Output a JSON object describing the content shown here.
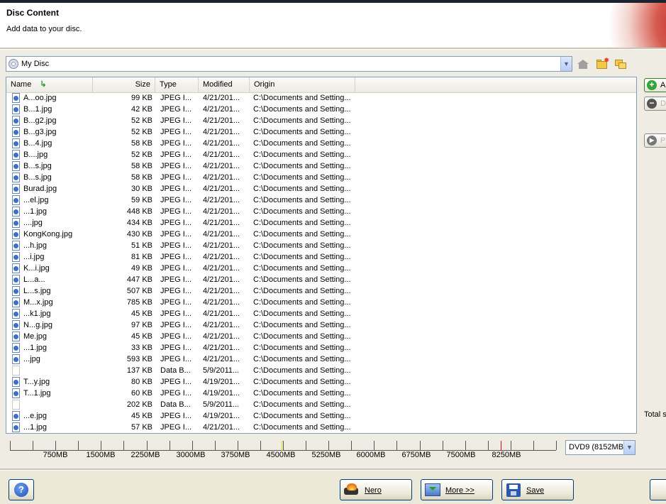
{
  "header": {
    "title": "Disc Content",
    "subtitle": "Add data to your disc."
  },
  "location": {
    "selected": "My Disc"
  },
  "columns": {
    "name": "Name",
    "size": "Size",
    "type": "Type",
    "modified": "Modified",
    "origin": "Origin"
  },
  "files": [
    {
      "name": "A...oo.jpg",
      "size": "99 KB",
      "type": "JPEG I...",
      "modified": "4/21/201...",
      "origin": "C:\\Documents and Setting..."
    },
    {
      "name": "B...1.jpg",
      "size": "42 KB",
      "type": "JPEG I...",
      "modified": "4/21/201...",
      "origin": "C:\\Documents and Setting..."
    },
    {
      "name": "B...g2.jpg",
      "size": "52 KB",
      "type": "JPEG I...",
      "modified": "4/21/201...",
      "origin": "C:\\Documents and Setting..."
    },
    {
      "name": "B...g3.jpg",
      "size": "52 KB",
      "type": "JPEG I...",
      "modified": "4/21/201...",
      "origin": "C:\\Documents and Setting..."
    },
    {
      "name": "B...4.jpg",
      "size": "58 KB",
      "type": "JPEG I...",
      "modified": "4/21/201...",
      "origin": "C:\\Documents and Setting..."
    },
    {
      "name": "B....jpg",
      "size": "52 KB",
      "type": "JPEG I...",
      "modified": "4/21/201...",
      "origin": "C:\\Documents and Setting..."
    },
    {
      "name": "B...s.jpg",
      "size": "58 KB",
      "type": "JPEG I...",
      "modified": "4/21/201...",
      "origin": "C:\\Documents and Setting..."
    },
    {
      "name": "B...s.jpg",
      "size": "58 KB",
      "type": "JPEG I...",
      "modified": "4/21/201...",
      "origin": "C:\\Documents and Setting..."
    },
    {
      "name": "Burad.jpg",
      "size": "30 KB",
      "type": "JPEG I...",
      "modified": "4/21/201...",
      "origin": "C:\\Documents and Setting..."
    },
    {
      "name": "...el.jpg",
      "size": "59 KB",
      "type": "JPEG I...",
      "modified": "4/21/201...",
      "origin": "C:\\Documents and Setting..."
    },
    {
      "name": "...1.jpg",
      "size": "448 KB",
      "type": "JPEG I...",
      "modified": "4/21/201...",
      "origin": "C:\\Documents and Setting..."
    },
    {
      "name": "....jpg",
      "size": "434 KB",
      "type": "JPEG I...",
      "modified": "4/21/201...",
      "origin": "C:\\Documents and Setting..."
    },
    {
      "name": "KongKong.jpg",
      "size": "430 KB",
      "type": "JPEG I...",
      "modified": "4/21/201...",
      "origin": "C:\\Documents and Setting..."
    },
    {
      "name": "...h.jpg",
      "size": "51 KB",
      "type": "JPEG I...",
      "modified": "4/21/201...",
      "origin": "C:\\Documents and Setting..."
    },
    {
      "name": "...i.jpg",
      "size": "81 KB",
      "type": "JPEG I...",
      "modified": "4/21/201...",
      "origin": "C:\\Documents and Setting..."
    },
    {
      "name": "K...i.jpg",
      "size": "49 KB",
      "type": "JPEG I...",
      "modified": "4/21/201...",
      "origin": "C:\\Documents and Setting..."
    },
    {
      "name": "L...a...",
      "size": "447 KB",
      "type": "JPEG I...",
      "modified": "4/21/201...",
      "origin": "C:\\Documents and Setting..."
    },
    {
      "name": "L...s.jpg",
      "size": "507 KB",
      "type": "JPEG I...",
      "modified": "4/21/201...",
      "origin": "C:\\Documents and Setting..."
    },
    {
      "name": "M...x.jpg",
      "size": "785 KB",
      "type": "JPEG I...",
      "modified": "4/21/201...",
      "origin": "C:\\Documents and Setting..."
    },
    {
      "name": "...k1.jpg",
      "size": "45 KB",
      "type": "JPEG I...",
      "modified": "4/21/201...",
      "origin": "C:\\Documents and Setting..."
    },
    {
      "name": "N...g.jpg",
      "size": "97 KB",
      "type": "JPEG I...",
      "modified": "4/21/201...",
      "origin": "C:\\Documents and Setting..."
    },
    {
      "name": "Me.jpg",
      "size": "45 KB",
      "type": "JPEG I...",
      "modified": "4/21/201...",
      "origin": "C:\\Documents and Setting..."
    },
    {
      "name": "...1.jpg",
      "size": "33 KB",
      "type": "JPEG I...",
      "modified": "4/21/201...",
      "origin": "C:\\Documents and Setting..."
    },
    {
      "name": "...jpg",
      "size": "593 KB",
      "type": "JPEG I...",
      "modified": "4/21/201...",
      "origin": "C:\\Documents and Setting..."
    },
    {
      "name": "",
      "size": "137 KB",
      "type": "Data B...",
      "modified": "5/9/2011...",
      "origin": "C:\\Documents and Setting...",
      "data": true
    },
    {
      "name": "T...y.jpg",
      "size": "80 KB",
      "type": "JPEG I...",
      "modified": "4/19/201...",
      "origin": "C:\\Documents and Setting..."
    },
    {
      "name": "T...1.jpg",
      "size": "60 KB",
      "type": "JPEG I...",
      "modified": "4/19/201...",
      "origin": "C:\\Documents and Setting..."
    },
    {
      "name": "",
      "size": "202 KB",
      "type": "Data B...",
      "modified": "5/9/2011...",
      "origin": "C:\\Documents and Setting...",
      "data": true
    },
    {
      "name": "...e.jpg",
      "size": "45 KB",
      "type": "JPEG I...",
      "modified": "4/19/201...",
      "origin": "C:\\Documents and Setting..."
    },
    {
      "name": "...1.jpg",
      "size": "57 KB",
      "type": "JPEG I...",
      "modified": "4/21/201...",
      "origin": "C:\\Documents and Setting..."
    }
  ],
  "sidebar": {
    "add": "A",
    "delete": "D",
    "play": "P",
    "total": "Total s"
  },
  "capacity": {
    "labels": [
      "750MB",
      "1500MB",
      "2250MB",
      "3000MB",
      "3750MB",
      "4500MB",
      "5250MB",
      "6000MB",
      "6750MB",
      "7500MB",
      "8250MB"
    ],
    "disc_type": "DVD9 (8152MB",
    "marker_colors": {
      "dvd5": "#e8e000",
      "dvd9": "#d01010"
    }
  },
  "footer": {
    "nero": "Nero",
    "more": "More >>",
    "save": "Save",
    "help_glyph": "?"
  }
}
